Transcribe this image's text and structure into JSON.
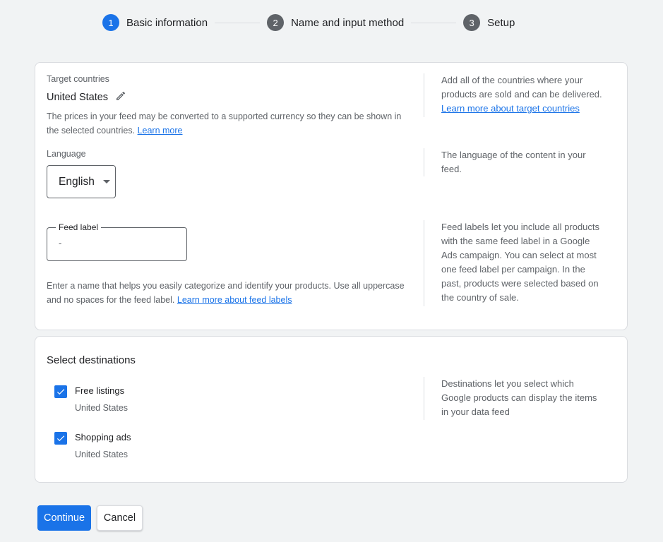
{
  "stepper": {
    "steps": [
      {
        "number": "1",
        "label": "Basic information",
        "state": "active"
      },
      {
        "number": "2",
        "label": "Name and input method",
        "state": "inactive"
      },
      {
        "number": "3",
        "label": "Setup",
        "state": "inactive"
      }
    ]
  },
  "basic_info": {
    "target_countries": {
      "label": "Target countries",
      "value": "United States",
      "note": "The prices in your feed may be converted to a supported currency so they can be shown in the selected countries.",
      "note_link": "Learn more",
      "side_help": "Add all of the countries where your products are sold and can be delivered.",
      "side_link": "Learn more about target countries"
    },
    "language": {
      "label": "Language",
      "selected": "English",
      "side_help": "The language of the content in your feed."
    },
    "feed_label": {
      "label": "Feed label",
      "value": "-",
      "note": "Enter a name that helps you easily categorize and identify your products. Use all uppercase and no spaces for the feed label.",
      "note_link": "Learn more about feed labels",
      "side_help": "Feed labels let you include all products with the same feed label in a Google Ads campaign. You can select at most one feed label per campaign. In the past, products were selected based on the country of sale."
    }
  },
  "destinations": {
    "title": "Select destinations",
    "items": [
      {
        "label": "Free listings",
        "sub": "United States",
        "checked": true
      },
      {
        "label": "Shopping ads",
        "sub": "United States",
        "checked": true
      }
    ],
    "side_help": "Destinations let you select which Google products can display the items in your data feed"
  },
  "actions": {
    "continue_label": "Continue",
    "cancel_label": "Cancel"
  },
  "colors": {
    "accent": "#1a73e8",
    "inactive_step": "#5f6368",
    "background": "#f1f3f4"
  }
}
